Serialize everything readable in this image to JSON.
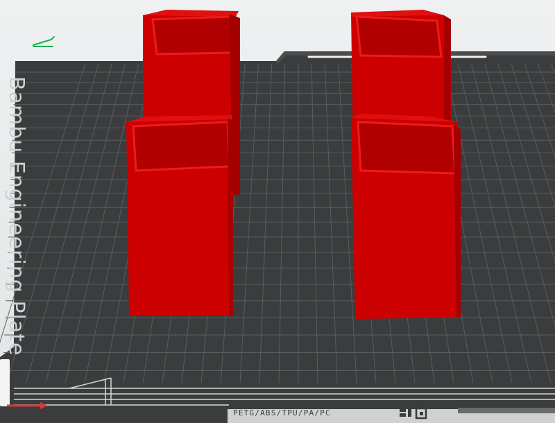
{
  "plate": {
    "label": "Bambu Engineering Plate",
    "materials": "PETG/ABS/TPU/PA/PC"
  },
  "colors": {
    "background": "#e6e8e9",
    "plate": "#3a3c3d",
    "grid": "#585b5c",
    "model": "#cc0000",
    "model_shadow": "#9e0000",
    "model_inner": "#b40000",
    "x_axis": "#d43a3a",
    "origin_marker": "#1cb24b"
  },
  "icons": {
    "origin_marker": "pencil-icon",
    "plate_logo": "plate-logo-icon"
  }
}
